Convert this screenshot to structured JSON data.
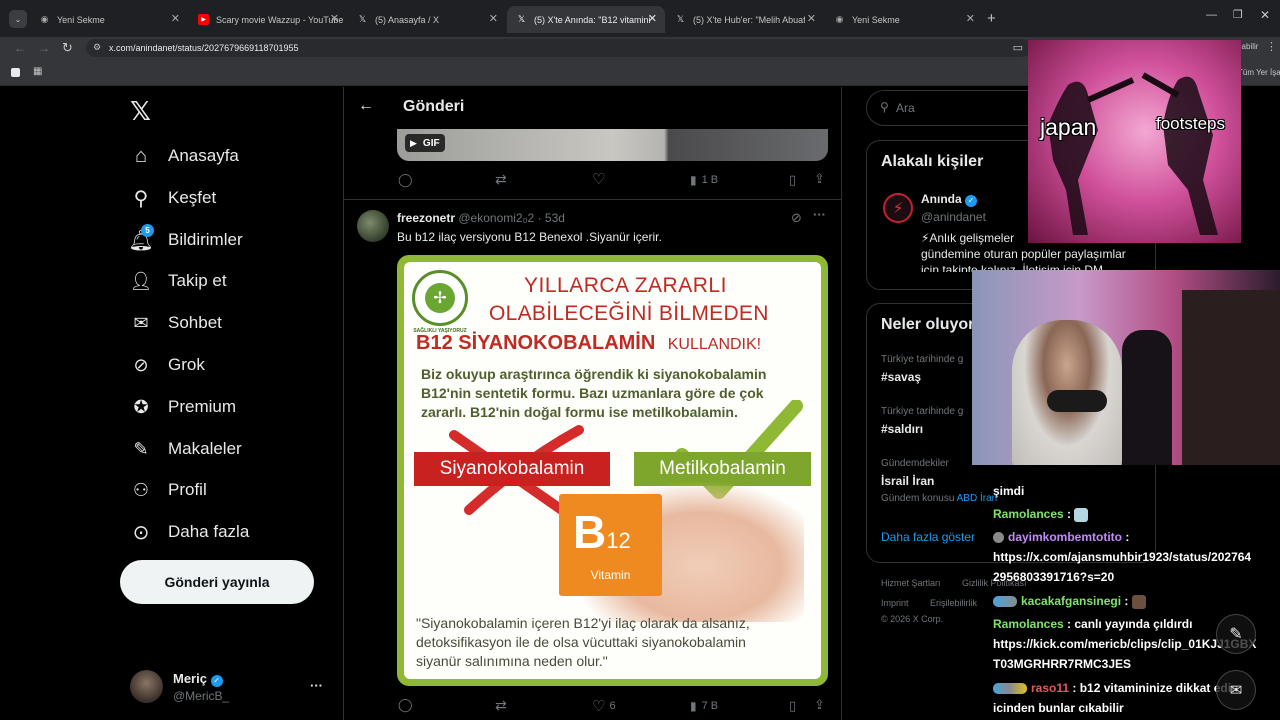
{
  "browser": {
    "tabs": [
      {
        "title": "Yeni Sekme",
        "icon": "chrome-icon"
      },
      {
        "title": "Scary movie Wazzup - YouTube",
        "icon": "youtube-icon"
      },
      {
        "title": "(5) Anasayfa / X",
        "icon": "x-icon"
      },
      {
        "title": "(5) X'te Anında: \"B12 vitamini ol",
        "icon": "x-icon"
      },
      {
        "title": "(5) X'te Hub'er: \"Melih Abuaf'ın",
        "icon": "x-icon"
      },
      {
        "title": "Yeni Sekme",
        "icon": "chrome-icon"
      }
    ],
    "new_tab": "+",
    "url": "x.com/anindanet/status/2027679669118701955",
    "bookmarks_right": "Tüm Yer İşaretleri",
    "profile_badge": "ilabilir"
  },
  "sidebar": {
    "items": [
      {
        "label": "Anasayfa",
        "icon": "home-icon"
      },
      {
        "label": "Keşfet",
        "icon": "search-icon"
      },
      {
        "label": "Bildirimler",
        "icon": "bell-icon",
        "badge": "5"
      },
      {
        "label": "Takip et",
        "icon": "follow-icon"
      },
      {
        "label": "Sohbet",
        "icon": "mail-icon"
      },
      {
        "label": "Grok",
        "icon": "grok-icon"
      },
      {
        "label": "Premium",
        "icon": "premium-icon"
      },
      {
        "label": "Makaleler",
        "icon": "articles-icon"
      },
      {
        "label": "Profil",
        "icon": "profile-icon"
      },
      {
        "label": "Daha fazla",
        "icon": "more-icon"
      }
    ],
    "post_button": "Gönderi yayınla",
    "account": {
      "name": "Meriç",
      "handle": "@MericB_",
      "more": "···"
    }
  },
  "main": {
    "header_title": "Gönderi",
    "prev_tweet": {
      "gif_badge": "GIF",
      "views": "1 B"
    },
    "tweet": {
      "author": "freezonetr",
      "handle": "@ekonomi2₀2",
      "time": "· 53d",
      "text": "Bu b12 ilaç versiyonu B12 Benexol .Siyanür içerir.",
      "likes": "6",
      "views": "7 B"
    },
    "infographic": {
      "logo": "SAĞLIKLI YAŞIYORUZ",
      "title_line1": "YILLARCA ZARARLI",
      "title_line2": "OLABİLECEĞİNİ BİLMEDEN",
      "title_line3_main": "B12 SİYANOKOBALAMİN",
      "title_line3_tail": "KULLANDIK!",
      "para_line1": "Biz okuyup araştırınca öğrendik ki siyanokobalamin",
      "para_line2": "B12'nin sentetik formu. Bazı uzmanlara göre de çok",
      "para_line3": "zararlı. B12'nin doğal formu ise metilkobalamin.",
      "label_bad": "Siyanokobalamin",
      "label_good": "Metilkobalamin",
      "box_main": "B",
      "box_sub": "12",
      "box_caption": "Vitamin",
      "quote_line1": "\"Siyanokobalamin içeren B12'yi ilaç olarak da alsanız,",
      "quote_line2": "detoksifikasyon ile de olsa vücuttaki siyanokobalamin",
      "quote_line3": "siyanür salınımına neden olur.\""
    }
  },
  "right": {
    "search_placeholder": "Ara",
    "related_title": "Alakalı kişiler",
    "person": {
      "name": "Anında",
      "handle": "@anindanet",
      "bio1": "⚡Anlık gelişmeler",
      "bio2": "gündemine oturan popüler paylaşımlar",
      "bio3": "için takipte kalınız. İletişim için DM"
    },
    "trends_title": "Neler oluyor",
    "trends": [
      {
        "meta": "Türkiye tarihinde g",
        "title": "#savaş"
      },
      {
        "meta": "Türkiye tarihinde g",
        "title": "#saldırı"
      },
      {
        "meta": "Gündemdekiler",
        "title": "İsrail İran",
        "extra": "Gündem konusu",
        "extra_link": "ABD İran"
      }
    ],
    "show_more": "Daha fazla göster",
    "footer": [
      "Hizmet Şartları",
      "Gizlilik Politikası",
      "Imprint",
      "Erişilebilirlik",
      "© 2026 X Corp."
    ]
  },
  "overlay": {
    "meme_left": "japan",
    "meme_right": "footsteps"
  },
  "chat": [
    {
      "user": "",
      "text": "şimdi"
    },
    {
      "user": "Ramolances",
      "text": " : "
    },
    {
      "user": "dayimkombemtotito",
      "text": " :"
    },
    {
      "user": "",
      "text": "https://x.com/ajansmuhbir1923/status/202764"
    },
    {
      "user": "",
      "text": "2956803391716?s=20"
    },
    {
      "user": "kacakafgansinegi",
      "text": " : "
    },
    {
      "user": "Ramolances",
      "text": " : canlı yayında çıldırdı"
    },
    {
      "user": "",
      "text": "https://kick.com/mericb/clips/clip_01KJJ1GBX"
    },
    {
      "user": "",
      "text": "T03MGRHRR7RMC3JES"
    },
    {
      "user": "raso11",
      "text": " : b12 vitamininize dikkat edin"
    },
    {
      "user": "",
      "text": "icinden bunlar cıkabilir"
    }
  ],
  "colors": {
    "accent": "#1d9bf0",
    "verified": "#1d9bf0",
    "good_green": "#8fb934",
    "bad_red": "#d52b2b"
  }
}
